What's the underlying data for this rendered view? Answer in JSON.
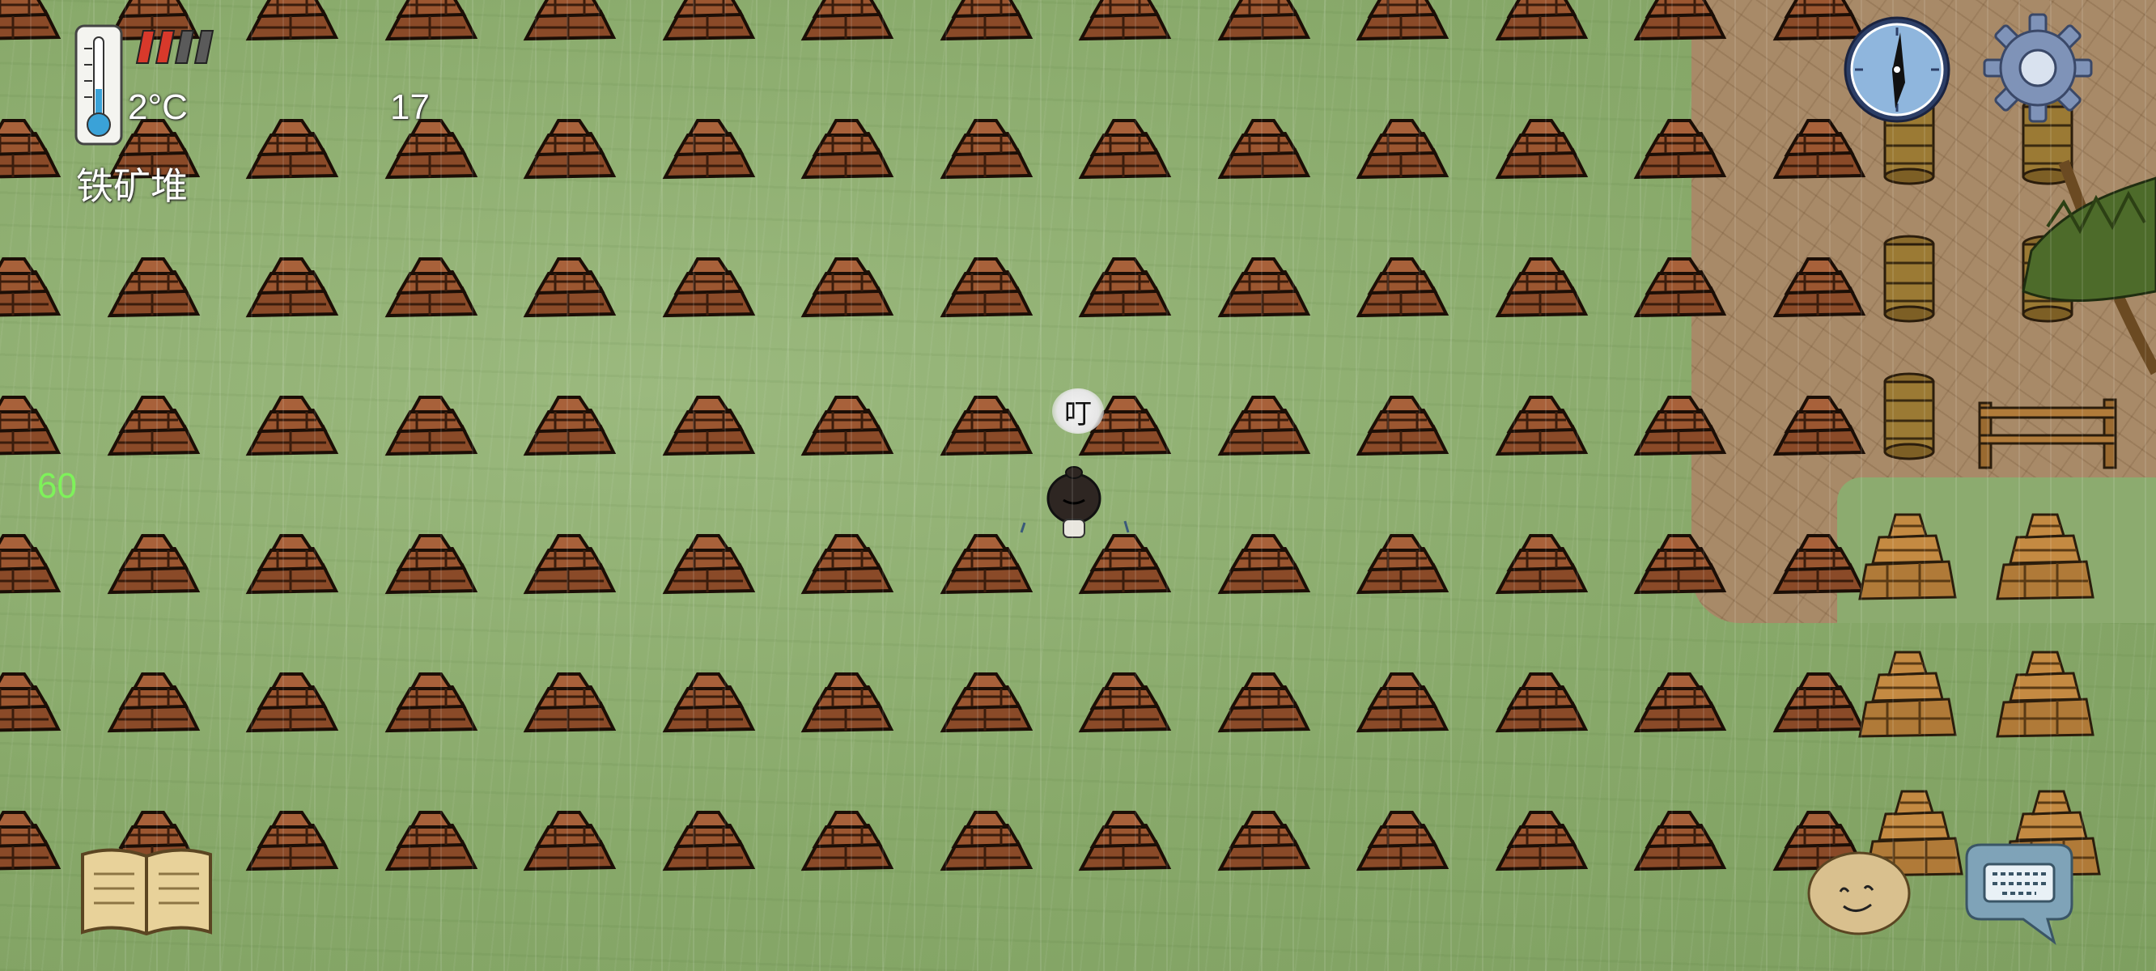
{
  "hud": {
    "temperature": "2°C",
    "counter": "17",
    "selected_item": "铁矿堆",
    "fps": "60",
    "health_segments_filled": 2,
    "health_segments_total": 4,
    "thermometer_level": 0.2
  },
  "speech_bubble": {
    "text": "叮"
  },
  "icons": {
    "thermometer": "thermometer-icon",
    "health": "health-bar-icon",
    "compass": "compass-icon",
    "settings": "gear-icon",
    "journal": "book-icon",
    "emote": "potato-face-icon",
    "chat": "keyboard-icon"
  },
  "colors": {
    "grass": "#8cab6f",
    "dirt": "#a88a68",
    "ore": "#8a4a28",
    "fps_text": "#7ef25a",
    "health_fill": "#d8392b",
    "health_empty": "#5a5a5a"
  },
  "world": {
    "tiles": "iron-ore-pile",
    "player": "player-character"
  }
}
